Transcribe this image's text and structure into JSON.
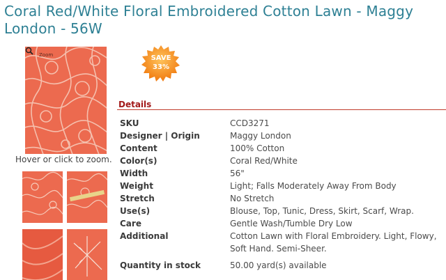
{
  "product": {
    "title": "Coral Red/White Floral Embroidered Cotton Lawn - Maggy London - 56W"
  },
  "gallery": {
    "zoom_label": "Zoom",
    "zoom_hint": "Hover or click to zoom.",
    "fabric_color": "#ec6a4f",
    "pattern_color": "#f6c9b8"
  },
  "badge": {
    "line1": "SAVE",
    "line2": "33%",
    "color": "#f7931e"
  },
  "details": {
    "heading": "Details",
    "rows": [
      {
        "label": "SKU",
        "value": "CCD3271"
      },
      {
        "label": "Designer | Origin",
        "value": "Maggy London"
      },
      {
        "label": "Content",
        "value": "100% Cotton"
      },
      {
        "label": "Color(s)",
        "value": "Coral Red/White"
      },
      {
        "label": "Width",
        "value": "56\""
      },
      {
        "label": "Weight",
        "value": "Light; Falls Moderately Away From Body"
      },
      {
        "label": "Stretch",
        "value": "No Stretch"
      },
      {
        "label": "Use(s)",
        "value": "Blouse, Top, Tunic, Dress, Skirt, Scarf, Wrap."
      },
      {
        "label": "Care",
        "value": "Gentle Wash/Tumble Dry Low"
      },
      {
        "label": "Additional",
        "value": "Cotton Lawn with Floral Embroidery. Light, Flowy, Soft Hand. Semi-Sheer."
      },
      {
        "label": "Quantity in stock",
        "value": "50.00 yard(s) available"
      }
    ]
  }
}
